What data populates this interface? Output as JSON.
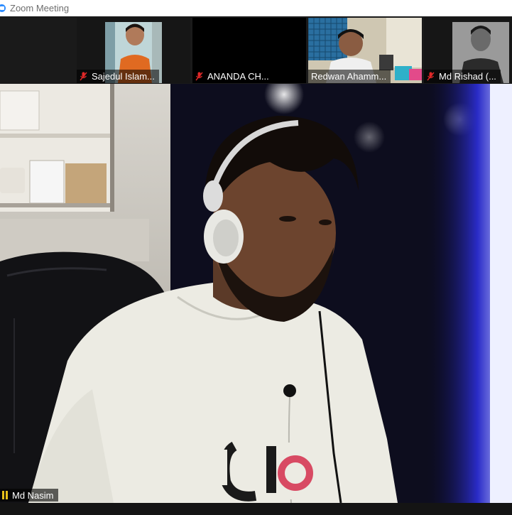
{
  "window": {
    "title": "Zoom Meeting"
  },
  "participants": [
    {
      "name": "Sajedul Islam...",
      "muted": true,
      "video": true
    },
    {
      "name": "ANANDA CH...",
      "muted": true,
      "video": false
    },
    {
      "name": "Redwan Ahamm...",
      "muted": false,
      "video": true
    },
    {
      "name": "Md Rishad (...",
      "muted": true,
      "video": true
    }
  ],
  "speaker": {
    "name": "Md Nasim",
    "audio_icon": "audio-level-icon"
  },
  "colors": {
    "accent": "#2d8cff",
    "mute_red": "#e02828",
    "audio_yellow": "#e8c21a"
  }
}
